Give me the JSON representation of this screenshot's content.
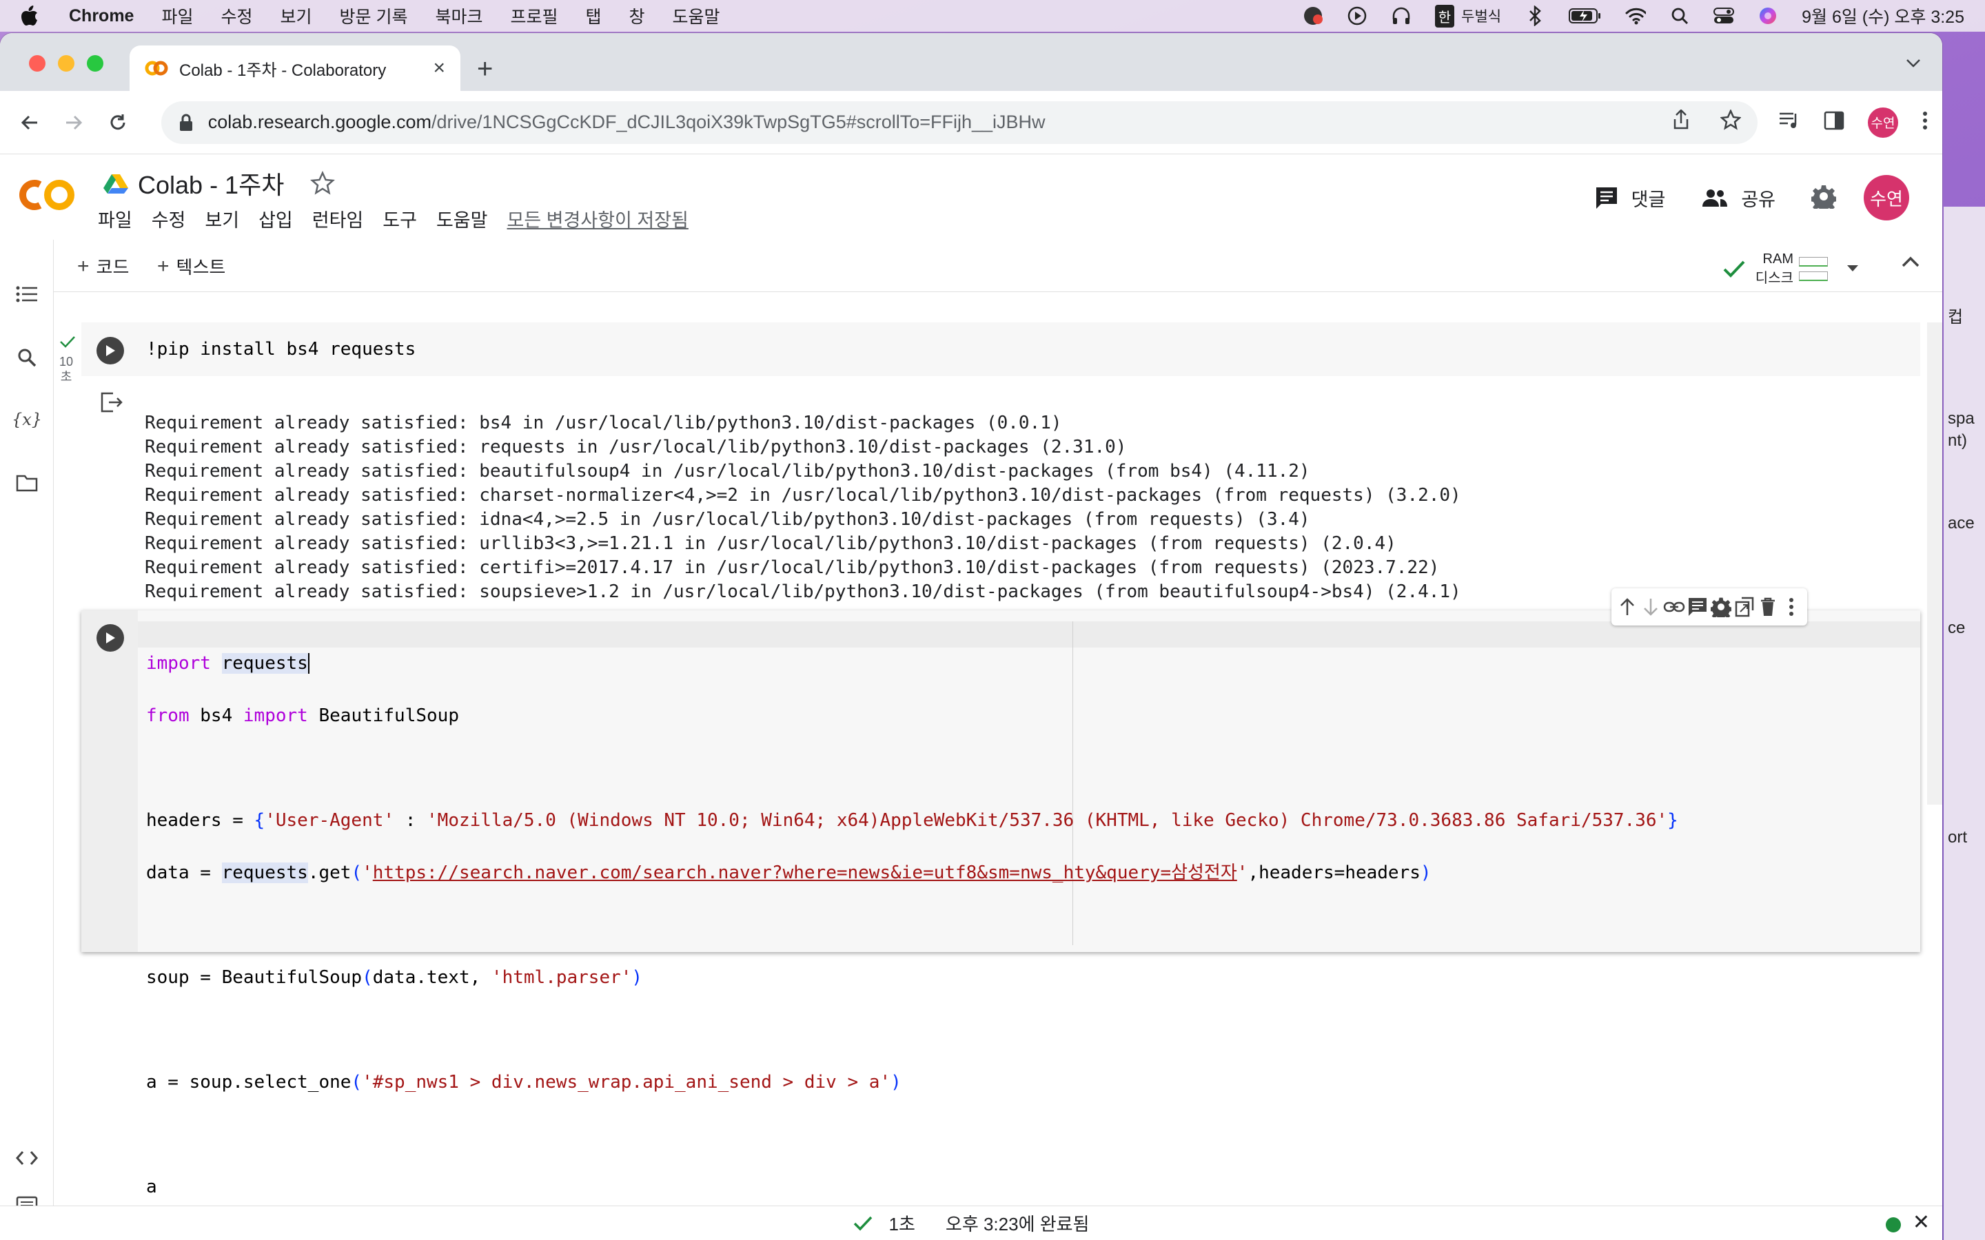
{
  "menubar": {
    "app": "Chrome",
    "items": [
      "파일",
      "수정",
      "보기",
      "방문 기록",
      "북마크",
      "프로필",
      "탭",
      "창",
      "도움말"
    ],
    "input_method": "두벌식",
    "datetime": "9월 6일 (수) 오후 3:25"
  },
  "browser": {
    "tab_title": "Colab - 1주차 - Colaboratory",
    "url_host": "colab.research.google.com",
    "url_path": "/drive/1NCSGgCcKDF_dCJIL3qoiX39kTwpSgTG5#scrollTo=FFijh__iJBHw",
    "profile_initial": "수연"
  },
  "colab": {
    "logo_text": "CO",
    "doc_title": "Colab  - 1주차",
    "menu": [
      "파일",
      "수정",
      "보기",
      "삽입",
      "런타임",
      "도구",
      "도움말"
    ],
    "saved_status": "모든 변경사항이 저장됨",
    "comment_label": "댓글",
    "share_label": "공유",
    "avatar_initial": "수연"
  },
  "notebook_toolbar": {
    "add_code": "코드",
    "add_text": "텍스트",
    "ram_label": "RAM",
    "disk_label": "디스크"
  },
  "cell1": {
    "exec_time": "10",
    "exec_unit": "초",
    "code": "!pip install bs4 requests",
    "output": [
      "Requirement already satisfied: bs4 in /usr/local/lib/python3.10/dist-packages (0.0.1)",
      "Requirement already satisfied: requests in /usr/local/lib/python3.10/dist-packages (2.31.0)",
      "Requirement already satisfied: beautifulsoup4 in /usr/local/lib/python3.10/dist-packages (from bs4) (4.11.2)",
      "Requirement already satisfied: charset-normalizer<4,>=2 in /usr/local/lib/python3.10/dist-packages (from requests) (3.2.0)",
      "Requirement already satisfied: idna<4,>=2.5 in /usr/local/lib/python3.10/dist-packages (from requests) (3.4)",
      "Requirement already satisfied: urllib3<3,>=1.21.1 in /usr/local/lib/python3.10/dist-packages (from requests) (2.0.4)",
      "Requirement already satisfied: certifi>=2017.4.17 in /usr/local/lib/python3.10/dist-packages (from requests) (2023.7.22)",
      "Requirement already satisfied: soupsieve>1.2 in /usr/local/lib/python3.10/dist-packages (from beautifulsoup4->bs4) (2.4.1)"
    ]
  },
  "cell2": {
    "line1_kw": "import",
    "line1_rest": "requests",
    "line2_kw1": "from",
    "line2_mod": " bs4 ",
    "line2_kw2": "import",
    "line2_rest": " BeautifulSoup",
    "line4_pre": "headers = ",
    "line4_key": "'User-Agent'",
    "line4_mid": " : ",
    "line4_val": "'Mozilla/5.0 (Windows NT 10.0; Win64; x64)AppleWebKit/537.36 (KHTML, like Gecko) Chrome/73.0.3683.86 Safari/537.36'",
    "line5_pre": "data = ",
    "line5_obj": "requests",
    "line5_call": ".get",
    "line5_url": "https://search.naver.com/search.naver?where=news&ie=utf8&sm=nws_hty&query=삼성전자",
    "line5_post": ",headers=headers",
    "line7_pre": "soup = BeautifulSoup",
    "line7_args": "data.text, ",
    "line7_str": "'html.parser'",
    "line9_pre": "a = soup.select_one",
    "line9_str": "'#sp_nws1 > div.news_wrap.api_ani_send > div > a'",
    "line11": "a"
  },
  "statusbar": {
    "duration": "1초",
    "completed": "오후 3:23에 완료됨"
  },
  "peek": [
    "컵",
    "spa",
    "nt)",
    "ace",
    "ce",
    "ort"
  ],
  "colors": {
    "keyword": "#af00db",
    "string": "#a31515",
    "bracket": "#0431fa",
    "avatar": "#d6336c",
    "check": "#1e8e3e"
  }
}
